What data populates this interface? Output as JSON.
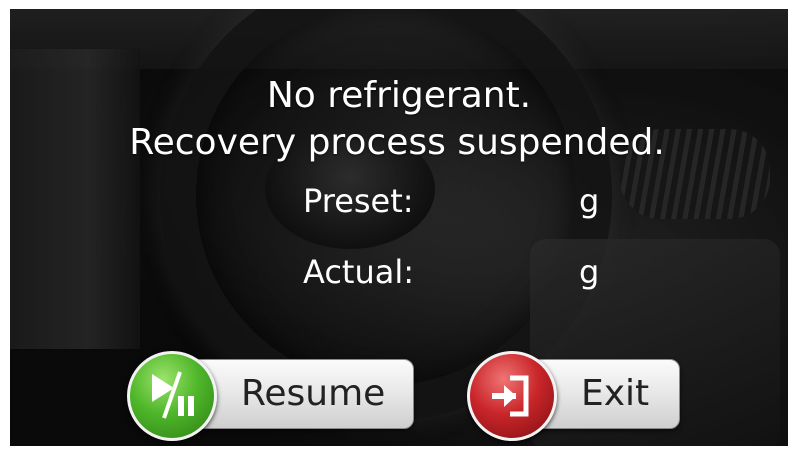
{
  "message": {
    "line1": "No refrigerant.",
    "line2": "Recovery process suspended."
  },
  "readings": {
    "preset_label": "Preset:",
    "preset_unit": "g",
    "actual_label": "Actual:",
    "actual_unit": "g"
  },
  "buttons": {
    "resume_label": "Resume",
    "exit_label": "Exit"
  },
  "icons": {
    "resume": "play-pause-icon",
    "exit": "exit-door-icon"
  },
  "colors": {
    "resume_accent": "#4fb62a",
    "exit_accent": "#c9262a"
  }
}
